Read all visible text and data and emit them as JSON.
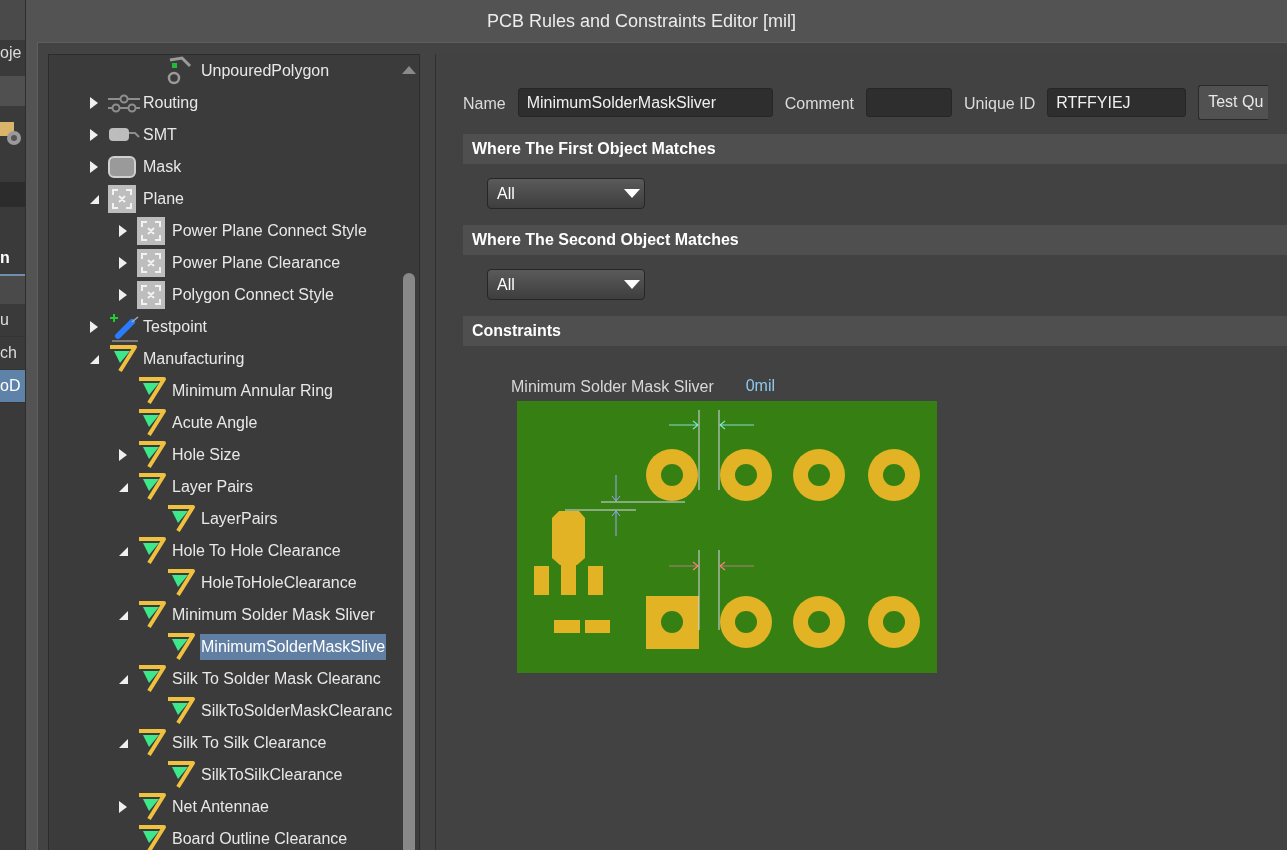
{
  "window": {
    "title": "PCB Rules and Constraints Editor [mil]"
  },
  "side_panel": {
    "project_label": "oje",
    "section_title": "n",
    "items": [
      {
        "label": "u",
        "selected": false
      },
      {
        "label": "ch",
        "selected": false
      },
      {
        "label": "oD",
        "selected": true
      }
    ]
  },
  "tree": {
    "scrolled_leaves": [
      {
        "label": "UnpouredPolygon",
        "kind": "polygon",
        "selected": false
      }
    ],
    "items": [
      {
        "label": "Routing",
        "kind": "routing",
        "expanded": false,
        "selected": false
      },
      {
        "label": "SMT",
        "kind": "smt",
        "expanded": false,
        "selected": false
      },
      {
        "label": "Mask",
        "kind": "mask",
        "expanded": false,
        "selected": false
      },
      {
        "label": "Plane",
        "kind": "plane",
        "expanded": true,
        "selected": false,
        "children": [
          {
            "label": "Power Plane Connect Style",
            "kind": "plane",
            "expanded": false,
            "selected": false
          },
          {
            "label": "Power Plane Clearance",
            "kind": "plane",
            "expanded": false,
            "selected": false
          },
          {
            "label": "Polygon Connect Style",
            "kind": "plane",
            "expanded": false,
            "selected": false
          }
        ]
      },
      {
        "label": "Testpoint",
        "kind": "testpoint",
        "expanded": false,
        "selected": false
      },
      {
        "label": "Manufacturing",
        "kind": "manufacturing",
        "expanded": true,
        "selected": false,
        "children": [
          {
            "label": "Minimum Annular Ring",
            "kind": "manufacturing",
            "selected": false
          },
          {
            "label": "Acute Angle",
            "kind": "manufacturing",
            "selected": false
          },
          {
            "label": "Hole Size",
            "kind": "manufacturing",
            "expanded": false,
            "selected": false
          },
          {
            "label": "Layer Pairs",
            "kind": "manufacturing",
            "expanded": true,
            "selected": false,
            "children": [
              {
                "label": "LayerPairs",
                "kind": "manufacturing",
                "selected": false
              }
            ]
          },
          {
            "label": "Hole To Hole Clearance",
            "kind": "manufacturing",
            "expanded": true,
            "selected": false,
            "children": [
              {
                "label": "HoleToHoleClearance",
                "kind": "manufacturing",
                "selected": false
              }
            ]
          },
          {
            "label": "Minimum Solder Mask Sliver",
            "kind": "manufacturing",
            "expanded": true,
            "selected": false,
            "children": [
              {
                "label": "MinimumSolderMaskSlive",
                "kind": "manufacturing",
                "selected": true
              }
            ]
          },
          {
            "label": "Silk To Solder Mask Clearanc",
            "kind": "manufacturing",
            "expanded": true,
            "selected": false,
            "children": [
              {
                "label": "SilkToSolderMaskClearanc",
                "kind": "manufacturing",
                "selected": false
              }
            ]
          },
          {
            "label": "Silk To Silk Clearance",
            "kind": "manufacturing",
            "expanded": true,
            "selected": false,
            "children": [
              {
                "label": "SilkToSilkClearance",
                "kind": "manufacturing",
                "selected": false
              }
            ]
          },
          {
            "label": "Net Antennae",
            "kind": "manufacturing",
            "expanded": false,
            "selected": false
          },
          {
            "label": "Board Outline Clearance",
            "kind": "manufacturing",
            "selected": false
          }
        ]
      }
    ]
  },
  "rule": {
    "name": {
      "label": "Name",
      "value": "MinimumSolderMaskSliver"
    },
    "comment": {
      "label": "Comment"
    },
    "unique_id": {
      "label": "Unique ID",
      "value": "RTFFYIEJ"
    },
    "test_button": "Test Qu"
  },
  "sections": [
    {
      "title": "Where The First Object Matches",
      "dropdown": "All"
    },
    {
      "title": "Where The Second Object Matches",
      "dropdown": "All"
    },
    {
      "title": "Constraints"
    }
  ],
  "constraint": {
    "label": "Minimum Solder Mask Sliver",
    "value": "0mil"
  }
}
